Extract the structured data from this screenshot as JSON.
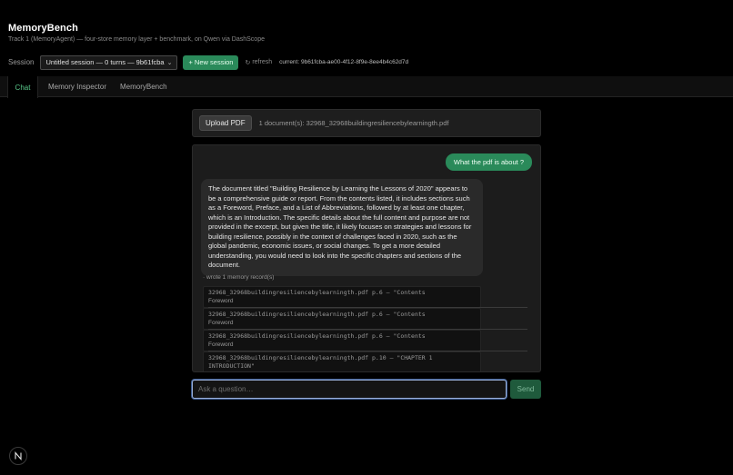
{
  "app": {
    "title": "MemoryBench",
    "subtitle": "Track 1 (MemoryAgent) — four-store memory layer + benchmark, on Qwen via DashScope"
  },
  "session": {
    "label": "Session",
    "selected": "Untitled session — 0 turns — 9b61fcba",
    "new_label": "+ New session",
    "refresh_label": "refresh",
    "current": "current: 9b61fcba-ae00-4f12-8f9e-8ee4b4c62d7d"
  },
  "tabs": [
    {
      "label": "Chat",
      "active": true
    },
    {
      "label": "Memory Inspector",
      "active": false
    },
    {
      "label": "MemoryBench",
      "active": false
    }
  ],
  "upload": {
    "button_label": "Upload PDF",
    "status": "1 document(s): 32968_32968buildingresiliencebylearningth.pdf"
  },
  "chat": {
    "user_message": "What the pdf is about ?",
    "assistant_message": "The document titled \"Building Resilience by Learning the Lessons of 2020\" appears to be a comprehensive guide or report. From the contents listed, it includes sections such as a Foreword, Preface, and a List of Abbreviations, followed by at least one chapter, which is an Introduction. The specific details about the full content and purpose are not provided in the excerpt, but given the title, it likely focuses on strategies and lessons for building resilience, possibly in the context of challenges faced in 2020, such as the global pandemic, economic issues, or social changes. To get a more detailed understanding, you would need to look into the specific chapters and sections of the document.",
    "memory_note": "· wrote 1 memory record(s)",
    "memory_records": [
      {
        "source": "32968_32968buildingresiliencebylearningth.pdf p.6 — \"Contents",
        "cont": "Foreword"
      },
      {
        "source": "32968_32968buildingresiliencebylearningth.pdf p.6 — \"Contents",
        "cont": "Foreword"
      },
      {
        "source": "32968_32968buildingresiliencebylearningth.pdf p.6 — \"Contents",
        "cont": "Foreword"
      },
      {
        "source": "32968_32968buildingresiliencebylearningth.pdf p.10 — \"CHAPTER 1 INTRODUCTION\"",
        "cont": ""
      }
    ]
  },
  "composer": {
    "placeholder": "Ask a question…",
    "send_label": "Send"
  },
  "badge": {
    "letter": "N"
  },
  "colors": {
    "accent_green": "#2a8a5a",
    "active_tab": "#59c88a",
    "input_focus": "#9bb0d8"
  }
}
